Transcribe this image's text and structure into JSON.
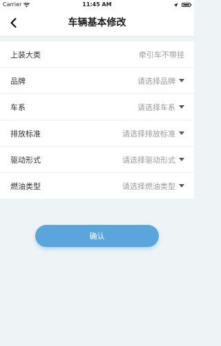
{
  "status_bar": {
    "carrier": "Carrier",
    "time": "11:45 AM"
  },
  "nav": {
    "title": "车辆基本修改"
  },
  "form": {
    "rows": [
      {
        "label": "上装大类",
        "value": "牵引车不带挂",
        "has_dropdown": false
      },
      {
        "label": "品牌",
        "value": "请选择品牌",
        "has_dropdown": true
      },
      {
        "label": "车系",
        "value": "请选择车系",
        "has_dropdown": true
      },
      {
        "label": "排放标准",
        "value": "请选择排放标准",
        "has_dropdown": true
      },
      {
        "label": "驱动形式",
        "value": "请选择驱动形式",
        "has_dropdown": true
      },
      {
        "label": "燃油类型",
        "value": "请选择燃油类型",
        "has_dropdown": true
      }
    ]
  },
  "actions": {
    "confirm_label": "确认"
  },
  "colors": {
    "accent": "#5aa6dc",
    "page_bg": "#eef3f6",
    "placeholder": "#9a9a9a"
  },
  "icons": {
    "back": "chevron-left-icon",
    "wifi": "wifi-icon",
    "location": "location-arrow-icon",
    "battery": "battery-icon",
    "dropdown": "caret-down-icon"
  }
}
